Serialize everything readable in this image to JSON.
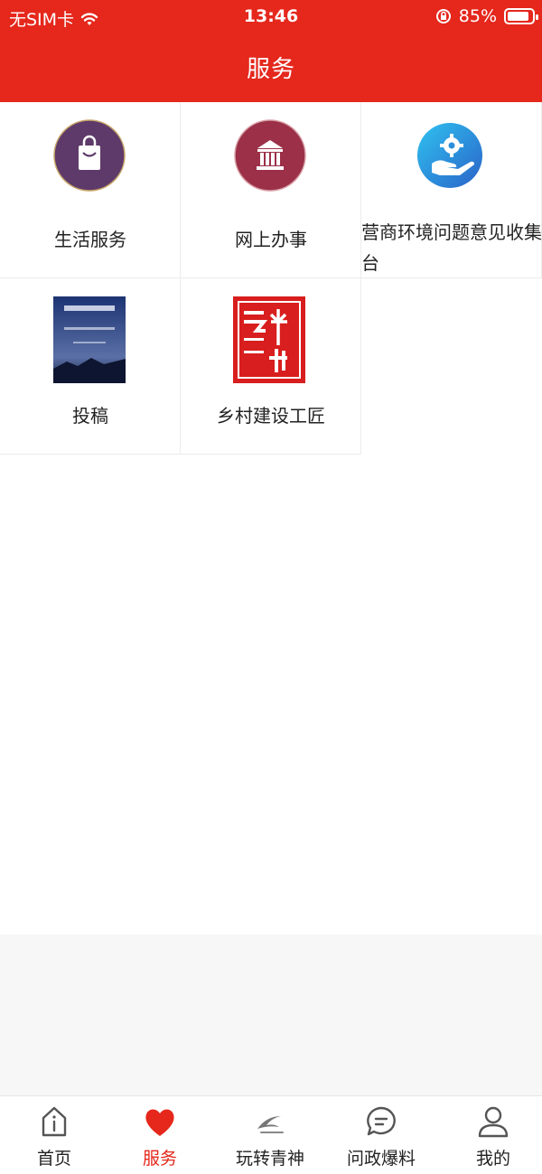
{
  "status_bar": {
    "carrier": "无SIM卡",
    "time": "13:46",
    "battery": "85%"
  },
  "header": {
    "title": "服务"
  },
  "services": [
    {
      "label": "生活服务"
    },
    {
      "label": "网上办事"
    },
    {
      "label": "营商环境问题意见收集平台"
    },
    {
      "label": "投稿"
    },
    {
      "label": "乡村建设工匠"
    }
  ],
  "tabs": [
    {
      "label": "首页"
    },
    {
      "label": "服务"
    },
    {
      "label": "玩转青神"
    },
    {
      "label": "问政爆料"
    },
    {
      "label": "我的"
    }
  ],
  "colors": {
    "brand_red": "#e5271c",
    "life_service_purple": "#5e3a6a",
    "online_affairs_red": "#9b3048",
    "business_blue": "#2aa6e3"
  }
}
